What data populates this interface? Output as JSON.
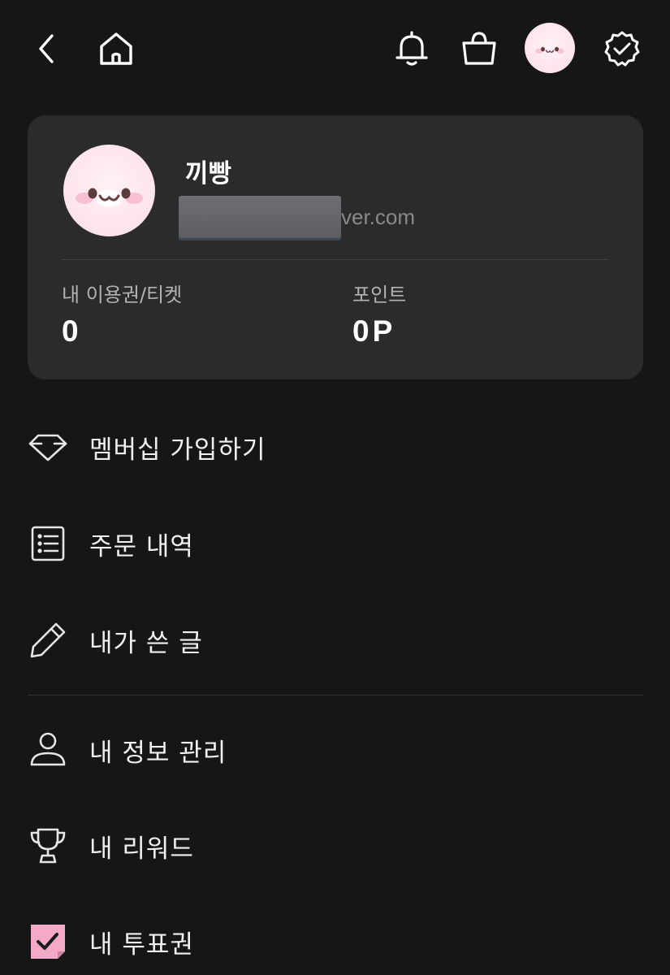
{
  "header": {
    "icons": {
      "back": "chevron-left-icon",
      "home": "home-icon",
      "notifications": "bell-icon",
      "cart": "shopping-bag-icon",
      "profile": "avatar",
      "verified": "verified-badge-icon"
    }
  },
  "profile": {
    "name": "끼빵",
    "email_visible": "ver.com",
    "stats": {
      "tickets_label": "내 이용권/티켓",
      "tickets_value": "0",
      "points_label": "포인트",
      "points_value": "0P"
    }
  },
  "menu": {
    "group1": [
      {
        "label": "멤버십 가입하기",
        "icon": "diamond-icon"
      },
      {
        "label": "주문 내역",
        "icon": "list-icon"
      },
      {
        "label": "내가 쓴 글",
        "icon": "pencil-icon"
      }
    ],
    "group2": [
      {
        "label": "내 정보 관리",
        "icon": "user-icon"
      },
      {
        "label": "내 리워드",
        "icon": "trophy-icon"
      },
      {
        "label": "내 투표권",
        "icon": "vote-ticket-icon"
      }
    ]
  },
  "colors": {
    "background": "#161616",
    "card": "#2b2b2c",
    "accent_pink": "#f4a9c8"
  }
}
